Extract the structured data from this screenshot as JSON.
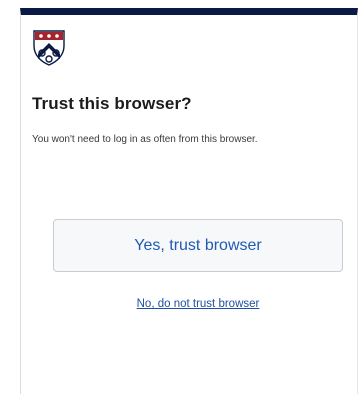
{
  "dialog": {
    "logo_icon": "penn-shield-icon",
    "title": "Trust this browser?",
    "message": "You won't need to log in as often from this browser.",
    "primary_button_label": "Yes, trust browser",
    "secondary_link_label": "No, do not trust browser"
  },
  "colors": {
    "top_bar": "#0b1a44",
    "button_text": "#1f5bb0",
    "link_text": "#1f4fa3",
    "shield_red": "#a3262e",
    "shield_blue": "#0b1a44"
  }
}
